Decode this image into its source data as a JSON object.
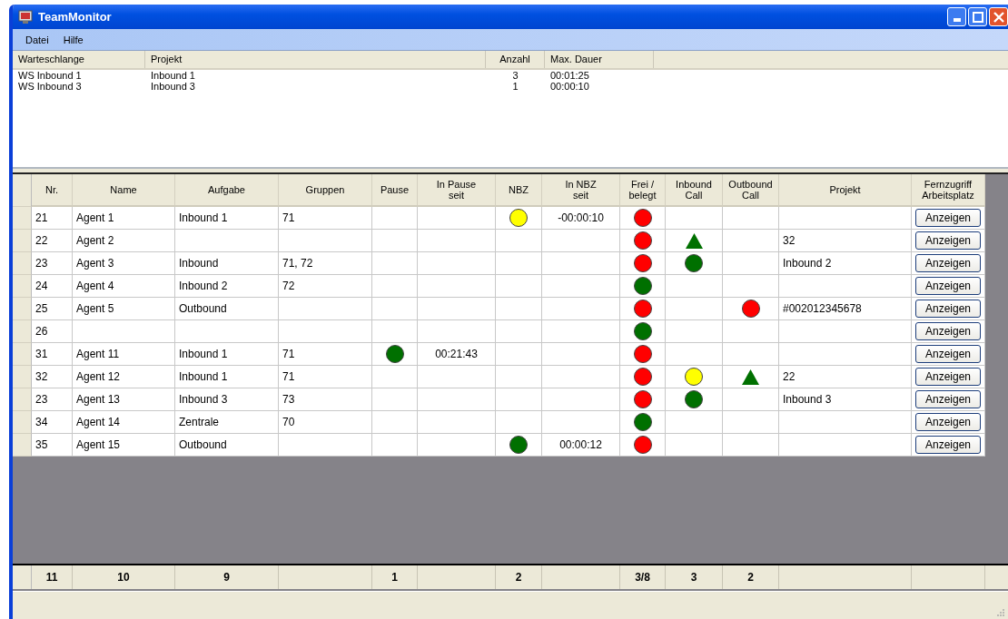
{
  "window": {
    "title": "TeamMonitor"
  },
  "menu": [
    "Datei",
    "Hilfe"
  ],
  "queues": {
    "columns": [
      "Warteschlange",
      "Projekt",
      "Anzahl",
      "Max. Dauer"
    ],
    "rows": [
      {
        "warteschlange": "WS Inbound 1",
        "projekt": "Inbound 1",
        "anzahl": "3",
        "max_dauer": "00:01:25"
      },
      {
        "warteschlange": "WS Inbound 3",
        "projekt": "Inbound 3",
        "anzahl": "1",
        "max_dauer": "00:00:10"
      }
    ]
  },
  "agents": {
    "columns": [
      {
        "label": "Nr.",
        "kind": "text"
      },
      {
        "label": "Name",
        "kind": "text"
      },
      {
        "label": "Aufgabe",
        "kind": "text"
      },
      {
        "label": "Gruppen",
        "kind": "text"
      },
      {
        "label": "Pause",
        "kind": "indicator"
      },
      {
        "label": "In Pause\nseit",
        "kind": "time"
      },
      {
        "label": "NBZ",
        "kind": "indicator"
      },
      {
        "label": "In NBZ\nseit",
        "kind": "time"
      },
      {
        "label": "Frei /\nbelegt",
        "kind": "indicator"
      },
      {
        "label": "Inbound\nCall",
        "kind": "indicator"
      },
      {
        "label": "Outbound\nCall",
        "kind": "indicator"
      },
      {
        "label": "Projekt",
        "kind": "text"
      },
      {
        "label": "Fernzugriff\nArbeitsplatz",
        "kind": "button"
      }
    ],
    "rows": [
      {
        "nr": "21",
        "name": "Agent 1",
        "aufgabe": "Inbound 1",
        "gruppen": "71",
        "nbz": {
          "kind": "circle",
          "color": "#ffff00"
        },
        "in_nbz_seit": "-00:00:10",
        "frei_belegt": {
          "kind": "circle",
          "color": "#ff0000"
        },
        "fernzugriff": "Anzeigen"
      },
      {
        "nr": "22",
        "name": "Agent 2",
        "frei_belegt": {
          "kind": "circle",
          "color": "#ff0000"
        },
        "inbound_call": {
          "kind": "triangle",
          "color": "#007000"
        },
        "projekt": "32",
        "fernzugriff": "Anzeigen"
      },
      {
        "nr": "23",
        "name": "Agent 3",
        "aufgabe": "Inbound",
        "gruppen": "71, 72",
        "frei_belegt": {
          "kind": "circle",
          "color": "#ff0000"
        },
        "inbound_call": {
          "kind": "circle",
          "color": "#007000"
        },
        "projekt": "Inbound 2",
        "fernzugriff": "Anzeigen"
      },
      {
        "nr": "24",
        "name": "Agent 4",
        "aufgabe": "Inbound 2",
        "gruppen": "72",
        "frei_belegt": {
          "kind": "circle",
          "color": "#007000"
        },
        "fernzugriff": "Anzeigen"
      },
      {
        "nr": "25",
        "name": "Agent 5",
        "aufgabe": "Outbound",
        "frei_belegt": {
          "kind": "circle",
          "color": "#ff0000"
        },
        "outbound_call": {
          "kind": "circle",
          "color": "#ff0000"
        },
        "projekt": "#002012345678",
        "fernzugriff": "Anzeigen"
      },
      {
        "nr": "26",
        "frei_belegt": {
          "kind": "circle",
          "color": "#007000"
        },
        "fernzugriff": "Anzeigen"
      },
      {
        "nr": "31",
        "name": "Agent 11",
        "aufgabe": "Inbound 1",
        "gruppen": "71",
        "pause": {
          "kind": "circle",
          "color": "#007000"
        },
        "in_pause_seit": "00:21:43",
        "frei_belegt": {
          "kind": "circle",
          "color": "#ff0000"
        },
        "fernzugriff": "Anzeigen"
      },
      {
        "nr": "32",
        "name": "Agent 12",
        "aufgabe": "Inbound 1",
        "gruppen": "71",
        "frei_belegt": {
          "kind": "circle",
          "color": "#ff0000"
        },
        "inbound_call": {
          "kind": "circle",
          "color": "#ffff00"
        },
        "outbound_call": {
          "kind": "triangle",
          "color": "#007000"
        },
        "projekt": "22",
        "fernzugriff": "Anzeigen"
      },
      {
        "nr": "23",
        "name": "Agent 13",
        "aufgabe": "Inbound 3",
        "gruppen": "73",
        "frei_belegt": {
          "kind": "circle",
          "color": "#ff0000"
        },
        "inbound_call": {
          "kind": "circle",
          "color": "#007000"
        },
        "projekt": "Inbound 3",
        "fernzugriff": "Anzeigen"
      },
      {
        "nr": "34",
        "name": "Agent 14",
        "aufgabe": "Zentrale",
        "gruppen": "70",
        "frei_belegt": {
          "kind": "circle",
          "color": "#007000"
        },
        "fernzugriff": "Anzeigen"
      },
      {
        "nr": "35",
        "name": "Agent 15",
        "aufgabe": "Outbound",
        "nbz": {
          "kind": "circle",
          "color": "#007000"
        },
        "in_nbz_seit": "00:00:12",
        "frei_belegt": {
          "kind": "circle",
          "color": "#ff0000"
        },
        "fernzugriff": "Anzeigen"
      }
    ],
    "totals": {
      "nr": "11",
      "name": "10",
      "aufgabe": "9",
      "pause": "1",
      "nbz": "2",
      "frei_belegt": "3/8",
      "inbound_call": "3",
      "outbound_call": "2"
    }
  }
}
